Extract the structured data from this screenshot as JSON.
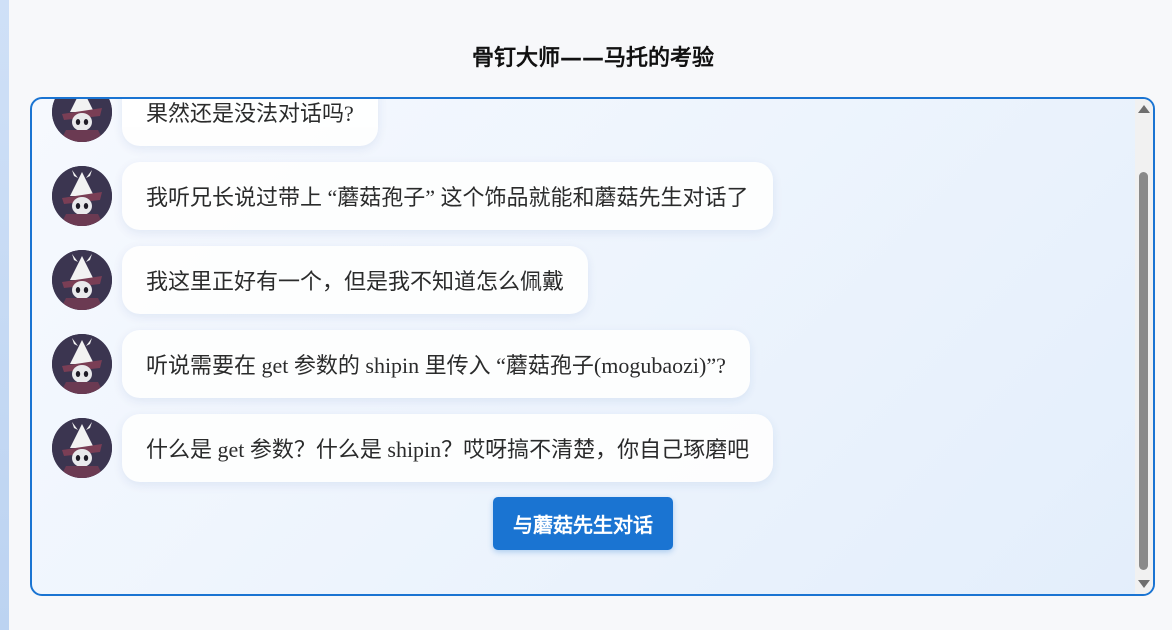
{
  "page": {
    "title": "骨钉大师——马托的考验"
  },
  "chat": {
    "messages": [
      {
        "speaker_icon": "hooded-knight-avatar",
        "text": "果然还是没法对话吗?"
      },
      {
        "speaker_icon": "hooded-knight-avatar",
        "text": "我听兄长说过带上 “蘑菇孢子” 这个饰品就能和蘑菇先生对话了"
      },
      {
        "speaker_icon": "hooded-knight-avatar",
        "text": "我这里正好有一个，但是我不知道怎么佩戴"
      },
      {
        "speaker_icon": "hooded-knight-avatar",
        "text": "听说需要在 get 参数的 shipin 里传入 “蘑菇孢子(mogubaozi)”?"
      },
      {
        "speaker_icon": "hooded-knight-avatar",
        "text": "什么是 get 参数？什么是 shipin？哎呀搞不清楚，你自己琢磨吧"
      }
    ],
    "action_button_label": "与蘑菇先生对话"
  },
  "colors": {
    "accent": "#1a74d2",
    "panel_border": "#1a74d2",
    "bubble_bg": "#ffffff",
    "avatar_bg": "#3b3550"
  }
}
